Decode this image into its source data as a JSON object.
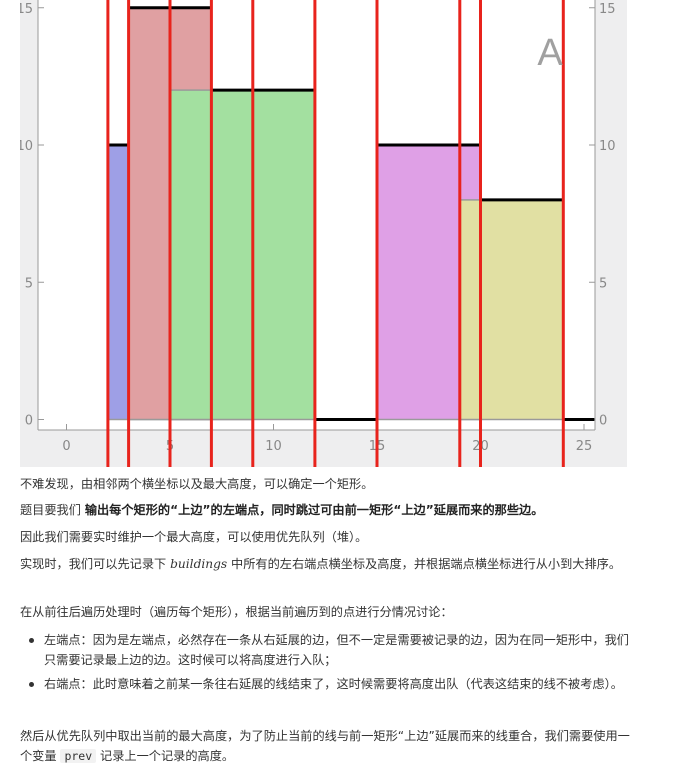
{
  "chart_data": {
    "type": "area",
    "corner_label": "A",
    "xlim": [
      -1,
      26
    ],
    "ylim": [
      -0.5,
      15.3
    ],
    "x_ticks": [
      0,
      5,
      10,
      15,
      20,
      25
    ],
    "y_ticks": [
      0,
      5,
      10,
      15
    ],
    "grid": false,
    "rectangles": [
      {
        "left": 2,
        "right": 9,
        "height": 10,
        "color": "#9e9fe6"
      },
      {
        "left": 3,
        "right": 7,
        "height": 15,
        "color": "#e0a0a2"
      },
      {
        "left": 5,
        "right": 12,
        "height": 12,
        "color": "#a3e0a0"
      },
      {
        "left": 15,
        "right": 20,
        "height": 10,
        "color": "#dfa0e6"
      },
      {
        "left": 19,
        "right": 24,
        "height": 8,
        "color": "#e1e0a3"
      }
    ],
    "skyline": [
      [
        2,
        10
      ],
      [
        3,
        15
      ],
      [
        7,
        12
      ],
      [
        12,
        0
      ],
      [
        15,
        10
      ],
      [
        20,
        8
      ],
      [
        24,
        0
      ]
    ],
    "vertical_lines": [
      2,
      3,
      5,
      7,
      9,
      12,
      15,
      19,
      20,
      24
    ]
  },
  "text": {
    "p1": "不难发现，由相邻两个横坐标以及最大高度，可以确定一个矩形。",
    "p2_a": "题目要我们 ",
    "p2_b": "输出每个矩形的“上边”的左端点，同时跳过可由前一矩形“上边”延展而来的那些边。",
    "p3": "因此我们需要实时维护一个最大高度，可以使用优先队列（堆）。",
    "p4_a": "实现时，我们可以先记录下 ",
    "p4_var": "buildings",
    "p4_b": " 中所有的左右端点横坐标及高度，并根据端点横坐标进行从小到大排序。",
    "p5": "在从前往后遍历处理时（遍历每个矩形），根据当前遍历到的点进行分情况讨论：",
    "li1": "左端点：因为是左端点，必然存在一条从右延展的边，但不一定是需要被记录的边，因为在同一矩形中，我们只需要记录最上边的边。这时候可以将高度进行入队；",
    "li2": "右端点：此时意味着之前某一条往右延展的线结束了，这时候需要将高度出队（代表这结束的线不被考虑）。",
    "p6_a": "然后从优先队列中取出当前的最大高度，为了防止当前的线与前一矩形“上边”延展而来的线重合，我们需要使用一个变量 ",
    "p6_code": "prev",
    "p6_b": " 记录上一个记录的高度。"
  }
}
